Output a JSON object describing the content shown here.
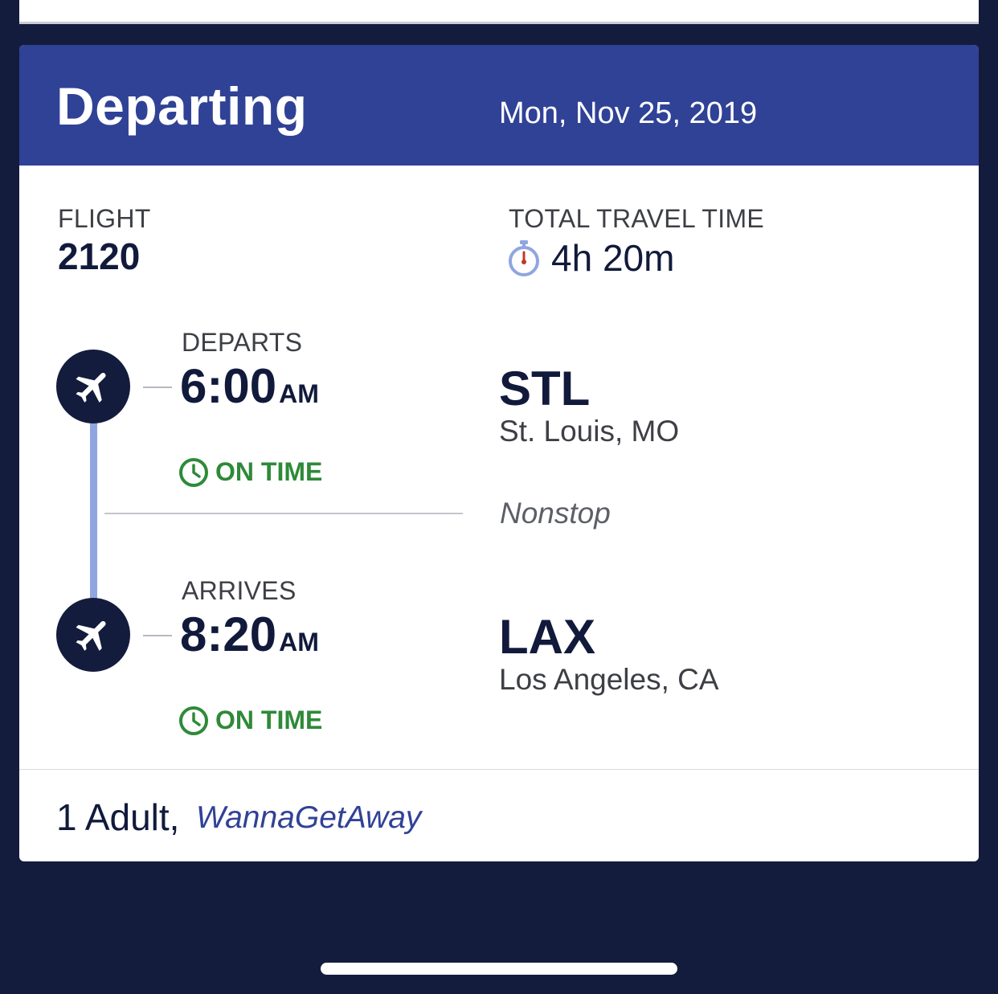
{
  "header": {
    "title": "Departing",
    "date": "Mon, Nov 25, 2019"
  },
  "flight": {
    "label": "FLIGHT",
    "number": "2120"
  },
  "travel_time": {
    "label": "TOTAL TRAVEL TIME",
    "value": "4h 20m",
    "icon": "stopwatch-icon"
  },
  "departure": {
    "label": "DEPARTS",
    "time": "6:00",
    "period": "AM",
    "status": "ON TIME",
    "airport_code": "STL",
    "city": "St. Louis, MO",
    "icon": "plane-icon"
  },
  "arrival": {
    "label": "ARRIVES",
    "time": "8:20",
    "period": "AM",
    "status": "ON TIME",
    "airport_code": "LAX",
    "city": "Los Angeles, CA",
    "icon": "plane-icon"
  },
  "route": {
    "stops": "Nonstop"
  },
  "footer": {
    "passengers": "1 Adult,",
    "fare_class": "WannaGetAway"
  },
  "colors": {
    "header_bg": "#304296",
    "page_bg": "#141c3d",
    "status_green": "#2e8a38",
    "timeline": "#8fa6e0",
    "fare_link": "#304296"
  }
}
